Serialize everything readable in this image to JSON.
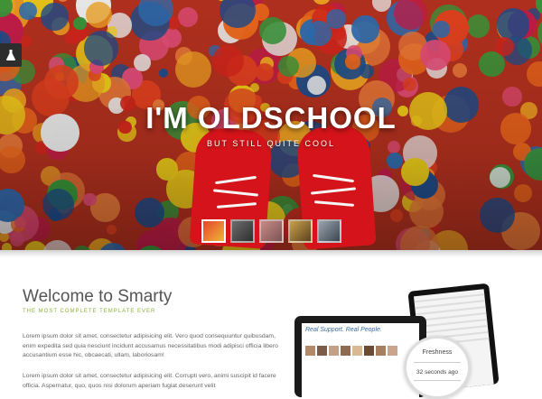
{
  "hero": {
    "title": "I'M OLDSCHOOL",
    "subtitle": "BUT STILL QUITE COOL",
    "thumbnails": [
      "slide-1",
      "slide-2",
      "slide-3",
      "slide-4",
      "slide-5"
    ],
    "active_thumbnail": 1
  },
  "side_tab": {
    "icon": "flask-icon"
  },
  "intro": {
    "heading": "Welcome to Smarty",
    "tagline": "THE MOST COMPLETE TEMPLATE EVER",
    "paragraph1": "Lorem ipsum dolor sit amet, consectetur adipisicing elit. Vero quod consequuntur quibusdam, enim expedita sed quia nesciunt incidunt accusamus necessitatibus modi adipisci officia libero accusantium esse hic, obcaecati, ullam, laboriosam!",
    "paragraph2": "Lorem ipsum dolor sit amet, consectetur adipisicing elit. Corrupti vero, animi suscipit id facere officia. Aspernatur, quo, quos nisi dolorum aperiam fugiat deserunt velit"
  },
  "devices": {
    "tablet_heading": "Real Support. Real People.",
    "bubble_label": "Freshness",
    "bubble_value": "32 seconds ago"
  },
  "colors": {
    "accent": "#8cb33a",
    "shoe": "#d4141a"
  }
}
